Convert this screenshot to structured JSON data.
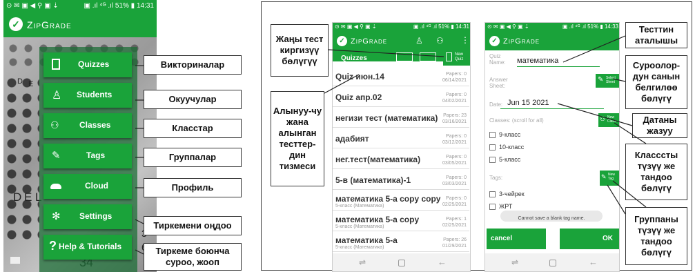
{
  "phone1": {
    "status_left": "⊙ ✉ ▣ ◀ ⚲ ▣ ⇣",
    "status_right": "▣ .ıl ⁴ᴳ .ıl 51% ▮ 14:31",
    "app_title": "ZipGrade",
    "menu": [
      {
        "label": "Quizzes",
        "icon": "document-icon"
      },
      {
        "label": "Students",
        "icon": "person-icon"
      },
      {
        "label": "Classes",
        "icon": "group-icon"
      },
      {
        "label": "Tags",
        "icon": "tag-icon"
      },
      {
        "label": "Cloud",
        "icon": "cloud-icon"
      },
      {
        "label": "Settings",
        "icon": "gear-icon"
      },
      {
        "label": "Help & Tutorials",
        "icon": "question-icon"
      }
    ],
    "background_letters": [
      "D",
      "E",
      "D",
      "E",
      "L",
      "3",
      "6",
      "34"
    ],
    "callouts": [
      "Викториналар",
      "Окуучулар",
      "Класстар",
      "Группалар",
      "Профиль",
      "Тиркемени оңдоо",
      "Тиркеме боюнча суроо, жооп"
    ]
  },
  "phone2": {
    "status_left": "⊙ ✉ ▣ ◀ ⚲ ▣ ⇣",
    "status_right": "▣ .ıl ⁴ᴳ .ıl 51% ▮ 14:31",
    "app_title": "ZipGrade",
    "tab_partial": "Quizzes",
    "new_quiz_label": "New Quiz",
    "quizzes": [
      {
        "name": "Quiz июн.14",
        "sub": "",
        "papers": "Papers: 0",
        "date": "06/14/2021"
      },
      {
        "name": "Quiz апр.02",
        "sub": "",
        "papers": "Papers: 0",
        "date": "04/02/2021"
      },
      {
        "name": "негизи тест (математика)",
        "sub": "",
        "papers": "Papers: 23",
        "date": "03/16/2021"
      },
      {
        "name": "адабият",
        "sub": "",
        "papers": "Papers: 0",
        "date": "03/12/2021"
      },
      {
        "name": "нег.тест(математика)",
        "sub": "",
        "papers": "Papers: 0",
        "date": "03/05/2021"
      },
      {
        "name": "5-в (математика)-1",
        "sub": "",
        "papers": "Papers: 0",
        "date": "03/03/2021"
      },
      {
        "name": "математика 5-а copy copy",
        "sub": "5-класс (Математика)",
        "papers": "Papers: 0",
        "date": "02/25/2021"
      },
      {
        "name": "математика 5-а copy",
        "sub": "5-класс (Математика)",
        "papers": "Papers: 1",
        "date": "02/25/2021"
      },
      {
        "name": "математика 5-а",
        "sub": "5-класс (Математика)",
        "papers": "Papers: 26",
        "date": "01/29/2021"
      }
    ],
    "callouts": [
      "Жаңы тест киргизүү бөлүгүү",
      "Алынуу-чу жана алынган тесттер-дин тизмеси"
    ]
  },
  "phone3": {
    "status_left": "⊙ ✉ ▣ ◀ ⚲ ▣ ⇣",
    "status_right": "▣ .ıl ⁴ᴳ .ıl 51% ▮ 14:33",
    "app_title": "ZipGrade",
    "quiz_name_label": "Quiz Name:",
    "quiz_name_value": "математика",
    "answer_sheet_label": "Answer Sheet:",
    "select_sheet_label": "Select Sheet",
    "date_label": "Date:",
    "date_value": "Jun 15 2021",
    "classes_label": "Classes: (scroll for all)",
    "new_class_label": "New Class",
    "classes": [
      "9-класс",
      "10-класс",
      "5-класс"
    ],
    "tags_label": "Tags:",
    "new_tag_label": "New Tag",
    "tags": [
      "3-чейрек",
      "ЖРТ"
    ],
    "toast": "Cannot save a blank tag name.",
    "cancel_label": "cancel",
    "ok_label": "OK",
    "callouts": [
      "Тесттин аталышы",
      "Суроолор-дун санын белгилөө бөлүгү",
      "Датаны жазуу",
      "Класссты түзүү же тандоо бөлүгү",
      "Группаны түзүү же тандоо бөлүгү"
    ]
  }
}
